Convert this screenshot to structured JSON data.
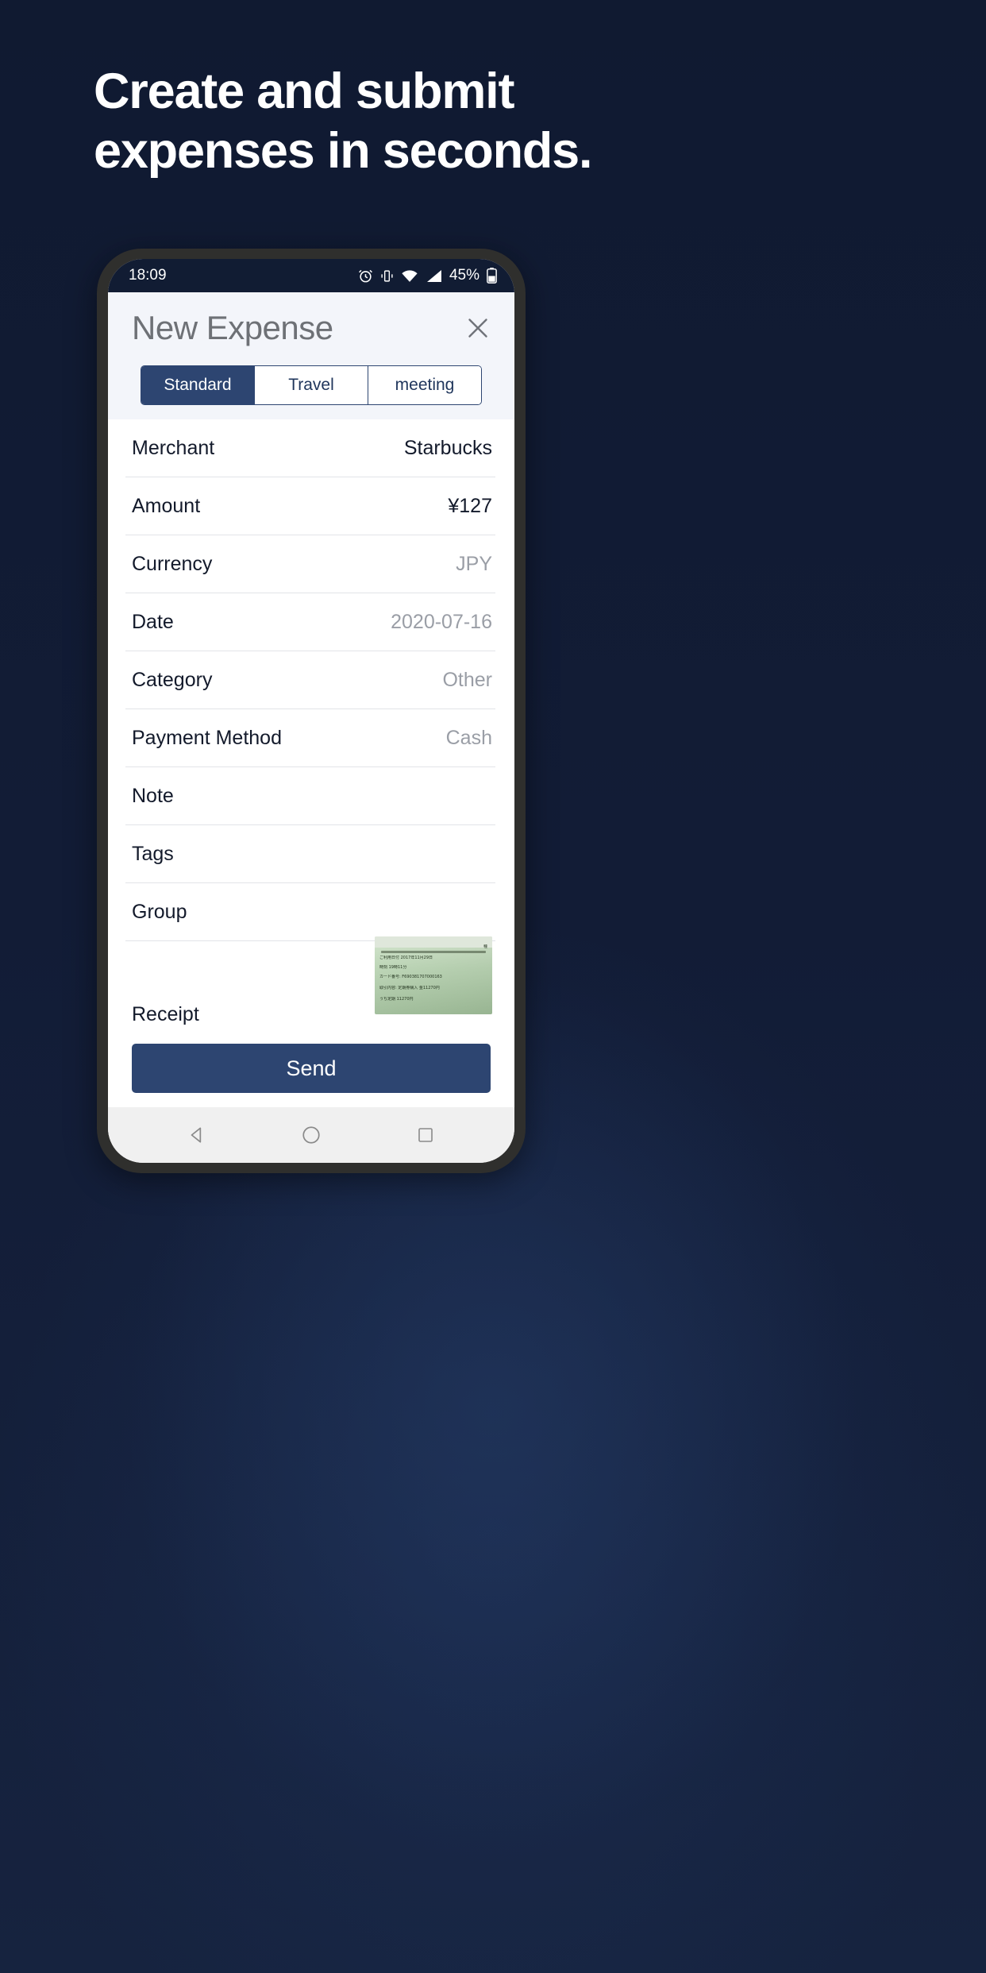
{
  "promo": {
    "headline_line1": "Create and submit",
    "headline_line2": "expenses in seconds.",
    "headline_color": "#ffffff",
    "background_color": "#101a33"
  },
  "phone": {
    "status_bar": {
      "time": "18:09",
      "battery_percent": "45%",
      "icons": [
        "alarm-icon",
        "vibrate-icon",
        "wifi-icon",
        "signal-icon",
        "battery-icon"
      ]
    },
    "nav_bar": {
      "back_label": "back-button",
      "home_label": "home-button",
      "recents_label": "recents-button"
    }
  },
  "app": {
    "title": "New Expense",
    "close_label": "✕",
    "accent_color": "#2d4571",
    "header_bg": "#f3f5fa",
    "tabs": [
      {
        "label": "Standard",
        "active": true
      },
      {
        "label": "Travel",
        "active": false
      },
      {
        "label": "meeting",
        "active": false
      }
    ],
    "fields": [
      {
        "label": "Merchant",
        "value": "Starbucks",
        "filled": true
      },
      {
        "label": "Amount",
        "value": "¥127",
        "filled": true
      },
      {
        "label": "Currency",
        "value": "JPY",
        "filled": false
      },
      {
        "label": "Date",
        "value": "2020-07-16",
        "filled": false
      },
      {
        "label": "Category",
        "value": "Other",
        "filled": false
      },
      {
        "label": "Payment Method",
        "value": "Cash",
        "filled": false
      },
      {
        "label": "Note",
        "value": "",
        "filled": false
      },
      {
        "label": "Tags",
        "value": "",
        "filled": false
      },
      {
        "label": "Group",
        "value": "",
        "filled": false
      }
    ],
    "receipt": {
      "label": "Receipt",
      "thumbnail_lines": [
        "種",
        "ご利用日付  2017年11月29日",
        "時刻            19時11分",
        "カード番号: F690381707000163",
        "取引内容: 定期券購入 金11270円",
        "うち定期      11270円"
      ]
    },
    "send_button": "Send"
  }
}
